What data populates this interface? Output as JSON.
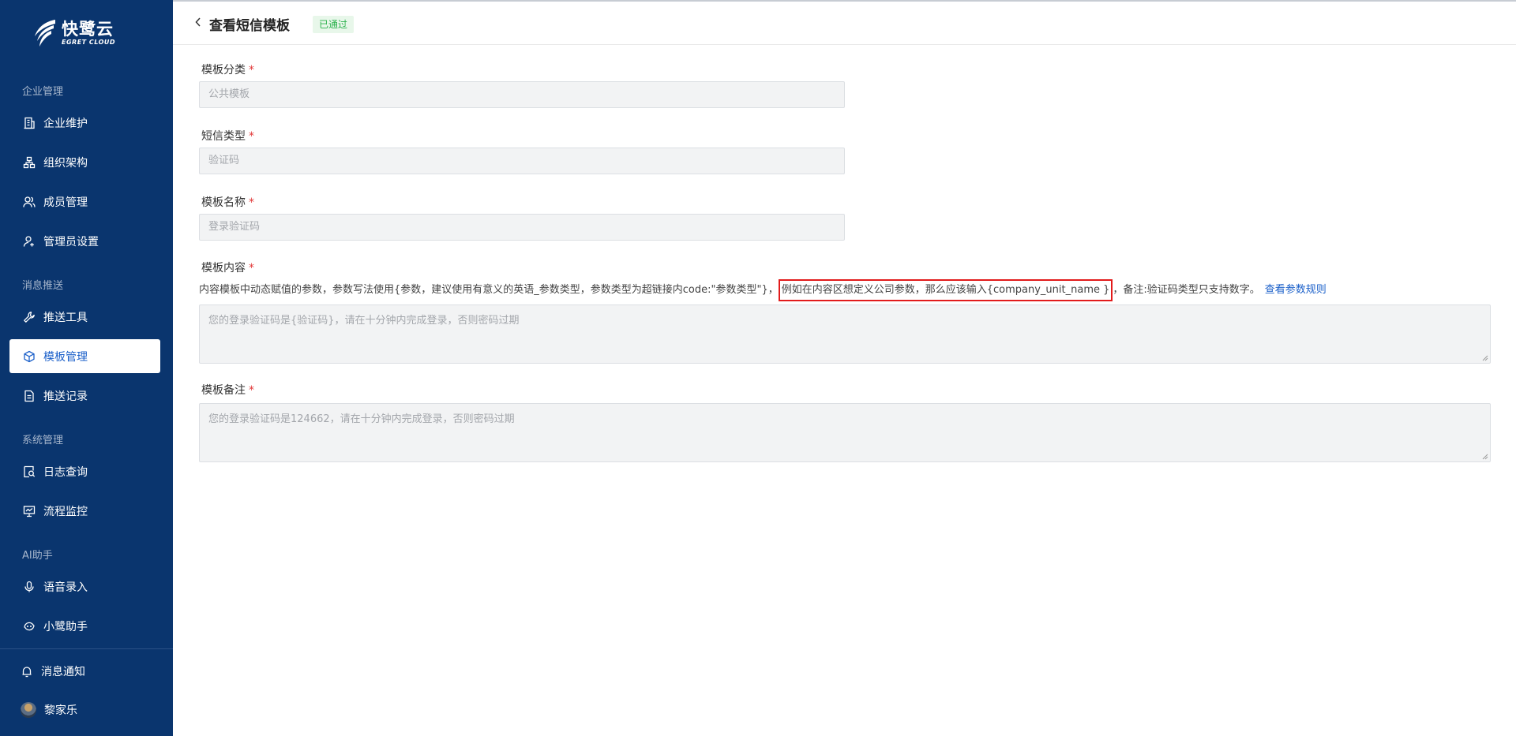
{
  "brand": {
    "name_cn": "快鹭云",
    "name_en": "EGRET CLOUD"
  },
  "sidebar": {
    "groups": [
      {
        "label": "企业管理",
        "items": [
          {
            "label": "企业维护",
            "icon": "building-icon"
          },
          {
            "label": "组织架构",
            "icon": "org-chart-icon"
          },
          {
            "label": "成员管理",
            "icon": "users-icon"
          },
          {
            "label": "管理员设置",
            "icon": "admin-user-icon"
          }
        ]
      },
      {
        "label": "消息推送",
        "items": [
          {
            "label": "推送工具",
            "icon": "wrench-icon"
          },
          {
            "label": "模板管理",
            "icon": "cube-icon",
            "active": true
          },
          {
            "label": "推送记录",
            "icon": "document-icon"
          }
        ]
      },
      {
        "label": "系统管理",
        "items": [
          {
            "label": "日志查询",
            "icon": "log-search-icon"
          },
          {
            "label": "流程监控",
            "icon": "monitor-icon"
          }
        ]
      },
      {
        "label": "AI助手",
        "items": [
          {
            "label": "语音录入",
            "icon": "microphone-icon"
          },
          {
            "label": "小鹭助手",
            "icon": "assistant-icon"
          }
        ]
      }
    ],
    "notifications_label": "消息通知",
    "user_name": "黎家乐"
  },
  "header": {
    "title": "查看短信模板",
    "status": "已通过"
  },
  "form": {
    "category": {
      "label": "模板分类",
      "value": "公共模板"
    },
    "sms_type": {
      "label": "短信类型",
      "value": "验证码"
    },
    "name": {
      "label": "模板名称",
      "value": "登录验证码"
    },
    "content": {
      "label": "模板内容",
      "hint_before": "内容模板中动态赋值的参数，参数写法使用{参数，建议使用有意义的英语_参数类型，参数类型为超链接内code:\"参数类型\"}，",
      "hint_highlight": "例如在内容区想定义公司参数，那么应该输入{company_unit_name }",
      "hint_after": "，备注:验证码类型只支持数字。",
      "hint_link": "查看参数规则",
      "value": "您的登录验证码是{验证码}，请在十分钟内完成登录，否则密码过期"
    },
    "remark": {
      "label": "模板备注",
      "value": "您的登录验证码是124662，请在十分钟内完成登录，否则密码过期"
    },
    "required_mark": "*"
  },
  "colors": {
    "sidebar_bg": "#0a356e",
    "accent": "#1a5fc9",
    "status_green": "#2bb24c",
    "highlight_border": "#e21b1b"
  }
}
